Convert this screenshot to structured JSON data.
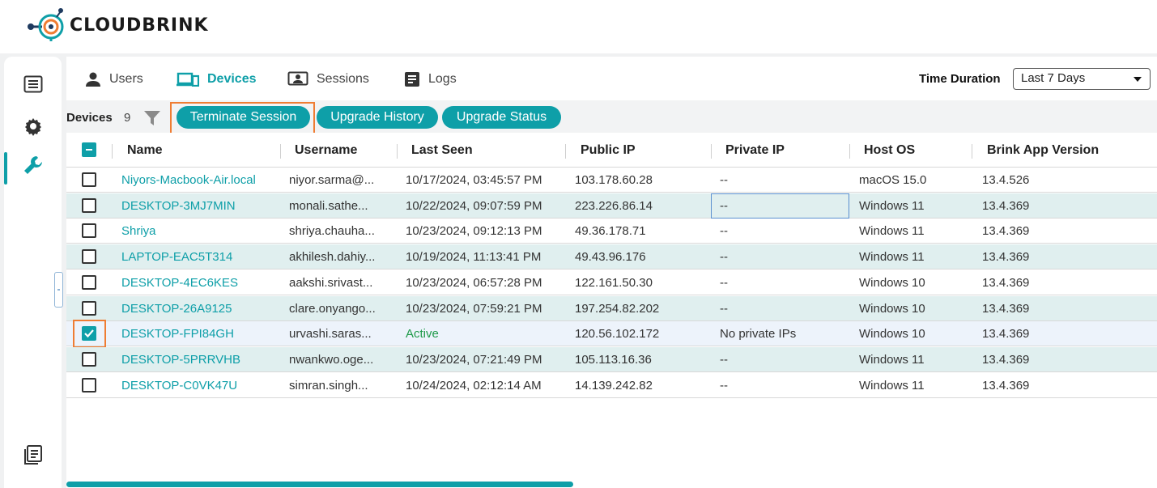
{
  "brand": {
    "name": "CLOUDBRINK"
  },
  "rail": {
    "items": [
      {
        "icon": "list-icon"
      },
      {
        "icon": "gear-icon"
      },
      {
        "icon": "wrench-icon"
      },
      {
        "icon": "document-icon"
      }
    ]
  },
  "tabs": [
    {
      "label": "Users",
      "icon": "user-icon"
    },
    {
      "label": "Devices",
      "icon": "devices-icon"
    },
    {
      "label": "Sessions",
      "icon": "sessions-icon"
    },
    {
      "label": "Logs",
      "icon": "logs-icon"
    }
  ],
  "time_duration": {
    "label": "Time Duration",
    "value": "Last 7 Days"
  },
  "toolbar": {
    "devices_label": "Devices",
    "devices_count": "9",
    "terminate_label": "Terminate Session",
    "upgrade_history_label": "Upgrade History",
    "upgrade_status_label": "Upgrade Status"
  },
  "table": {
    "columns": [
      "Name",
      "Username",
      "Last Seen",
      "Public IP",
      "Private IP",
      "Host OS",
      "Brink App Version"
    ],
    "rows": [
      {
        "name": "Niyors-Macbook-Air.local",
        "username": "niyor.sarma@...",
        "last_seen": "10/17/2024, 03:45:57 PM",
        "public_ip": "103.178.60.28",
        "private_ip": "--",
        "host_os": "macOS 15.0",
        "version": "13.4.526",
        "checked": false
      },
      {
        "name": "DESKTOP-3MJ7MIN",
        "username": "monali.sathe...",
        "last_seen": "10/22/2024, 09:07:59 PM",
        "public_ip": "223.226.86.14",
        "private_ip": "--",
        "host_os": "Windows 11",
        "version": "13.4.369",
        "checked": false
      },
      {
        "name": "Shriya",
        "username": "shriya.chauha...",
        "last_seen": "10/23/2024, 09:12:13 PM",
        "public_ip": "49.36.178.71",
        "private_ip": "--",
        "host_os": "Windows 11",
        "version": "13.4.369",
        "checked": false
      },
      {
        "name": "LAPTOP-EAC5T314",
        "username": "akhilesh.dahiy...",
        "last_seen": "10/19/2024, 11:13:41 PM",
        "public_ip": "49.43.96.176",
        "private_ip": "--",
        "host_os": "Windows 11",
        "version": "13.4.369",
        "checked": false
      },
      {
        "name": "DESKTOP-4EC6KES",
        "username": "aakshi.srivast...",
        "last_seen": "10/23/2024, 06:57:28 PM",
        "public_ip": "122.161.50.30",
        "private_ip": "--",
        "host_os": "Windows 10",
        "version": "13.4.369",
        "checked": false
      },
      {
        "name": "DESKTOP-26A9125",
        "username": "clare.onyango...",
        "last_seen": "10/23/2024, 07:59:21 PM",
        "public_ip": "197.254.82.202",
        "private_ip": "--",
        "host_os": "Windows 10",
        "version": "13.4.369",
        "checked": false
      },
      {
        "name": "DESKTOP-FPI84GH",
        "username": "urvashi.saras...",
        "last_seen": "Active",
        "public_ip": "120.56.102.172",
        "private_ip": "No private IPs",
        "host_os": "Windows 10",
        "version": "13.4.369",
        "checked": true
      },
      {
        "name": "DESKTOP-5PRRVHB",
        "username": "nwankwo.oge...",
        "last_seen": "10/23/2024, 07:21:49 PM",
        "public_ip": "105.113.16.36",
        "private_ip": "--",
        "host_os": "Windows 11",
        "version": "13.4.369",
        "checked": false
      },
      {
        "name": "DESKTOP-C0VK47U",
        "username": "simran.singh...",
        "last_seen": "10/24/2024, 02:12:14 AM",
        "public_ip": "14.139.242.82",
        "private_ip": "--",
        "host_os": "Windows 11",
        "version": "13.4.369",
        "checked": false
      }
    ]
  },
  "colors": {
    "accent": "#0e9fa8",
    "highlight": "#ef7d33",
    "row_alt": "#e0efef",
    "active_status": "#1f9a4a"
  }
}
